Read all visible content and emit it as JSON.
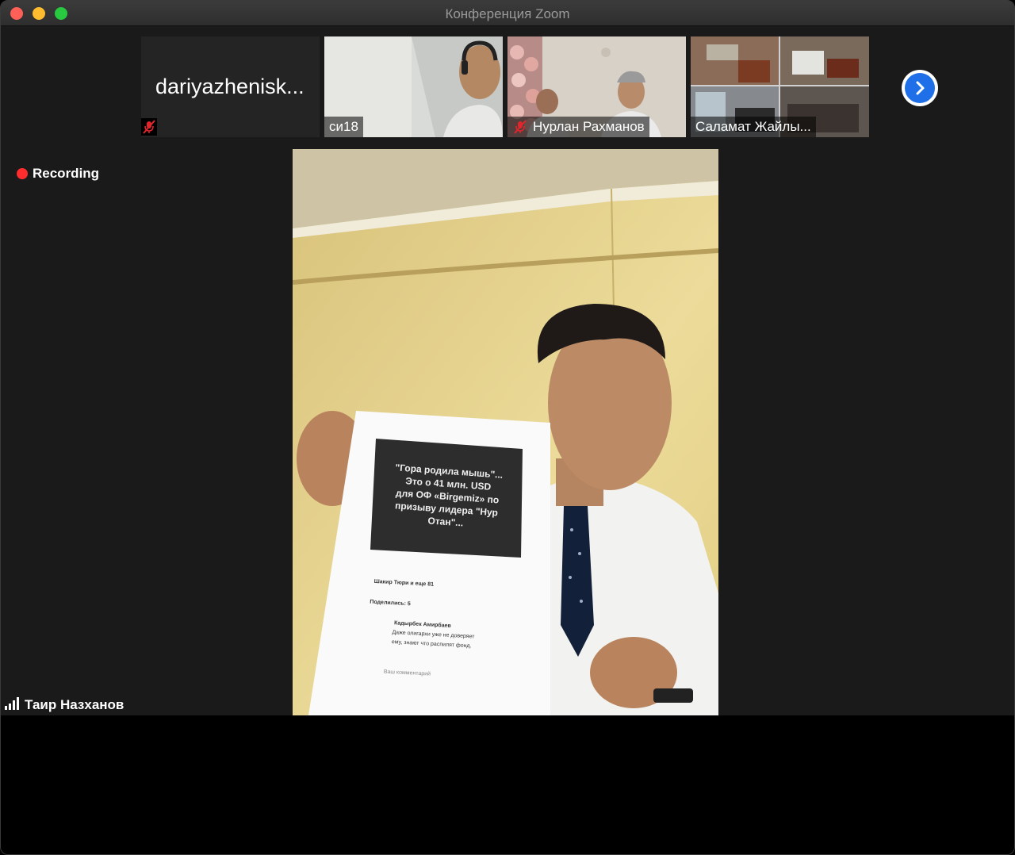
{
  "window": {
    "title": "Конференция Zoom"
  },
  "participants": [
    {
      "name": "dariyazhenisk...",
      "muted": true,
      "video": false
    },
    {
      "name": "си18",
      "muted": false,
      "video": true
    },
    {
      "name": "Нурлан Рахманов",
      "muted": true,
      "video": true
    },
    {
      "name": "Саламат Жайлы...",
      "muted": false,
      "video": true
    }
  ],
  "recording": {
    "label": "Recording"
  },
  "active_speaker": {
    "name": "Таир Назханов"
  },
  "shown_document": {
    "lines": [
      "\"Гора родила мышь\"...",
      "Это о 41 млн. USD",
      "для ОФ «Birgemiz» по",
      "призыву лидера \"Нур",
      "Отан\"..."
    ],
    "reactions": "Шакир Тюри и еще 81",
    "shares": "Поделились: 5",
    "comment_author": "Кадырбек Амирбаев",
    "comment_text": [
      "Даже олигархи уже не доверяет",
      "ему, знают что распилят фонд."
    ],
    "comment_placeholder": "Ваш комментарий"
  },
  "colors": {
    "recording": "#ff2d2d",
    "accent": "#1e6fe8",
    "mute": "#e0262b"
  }
}
